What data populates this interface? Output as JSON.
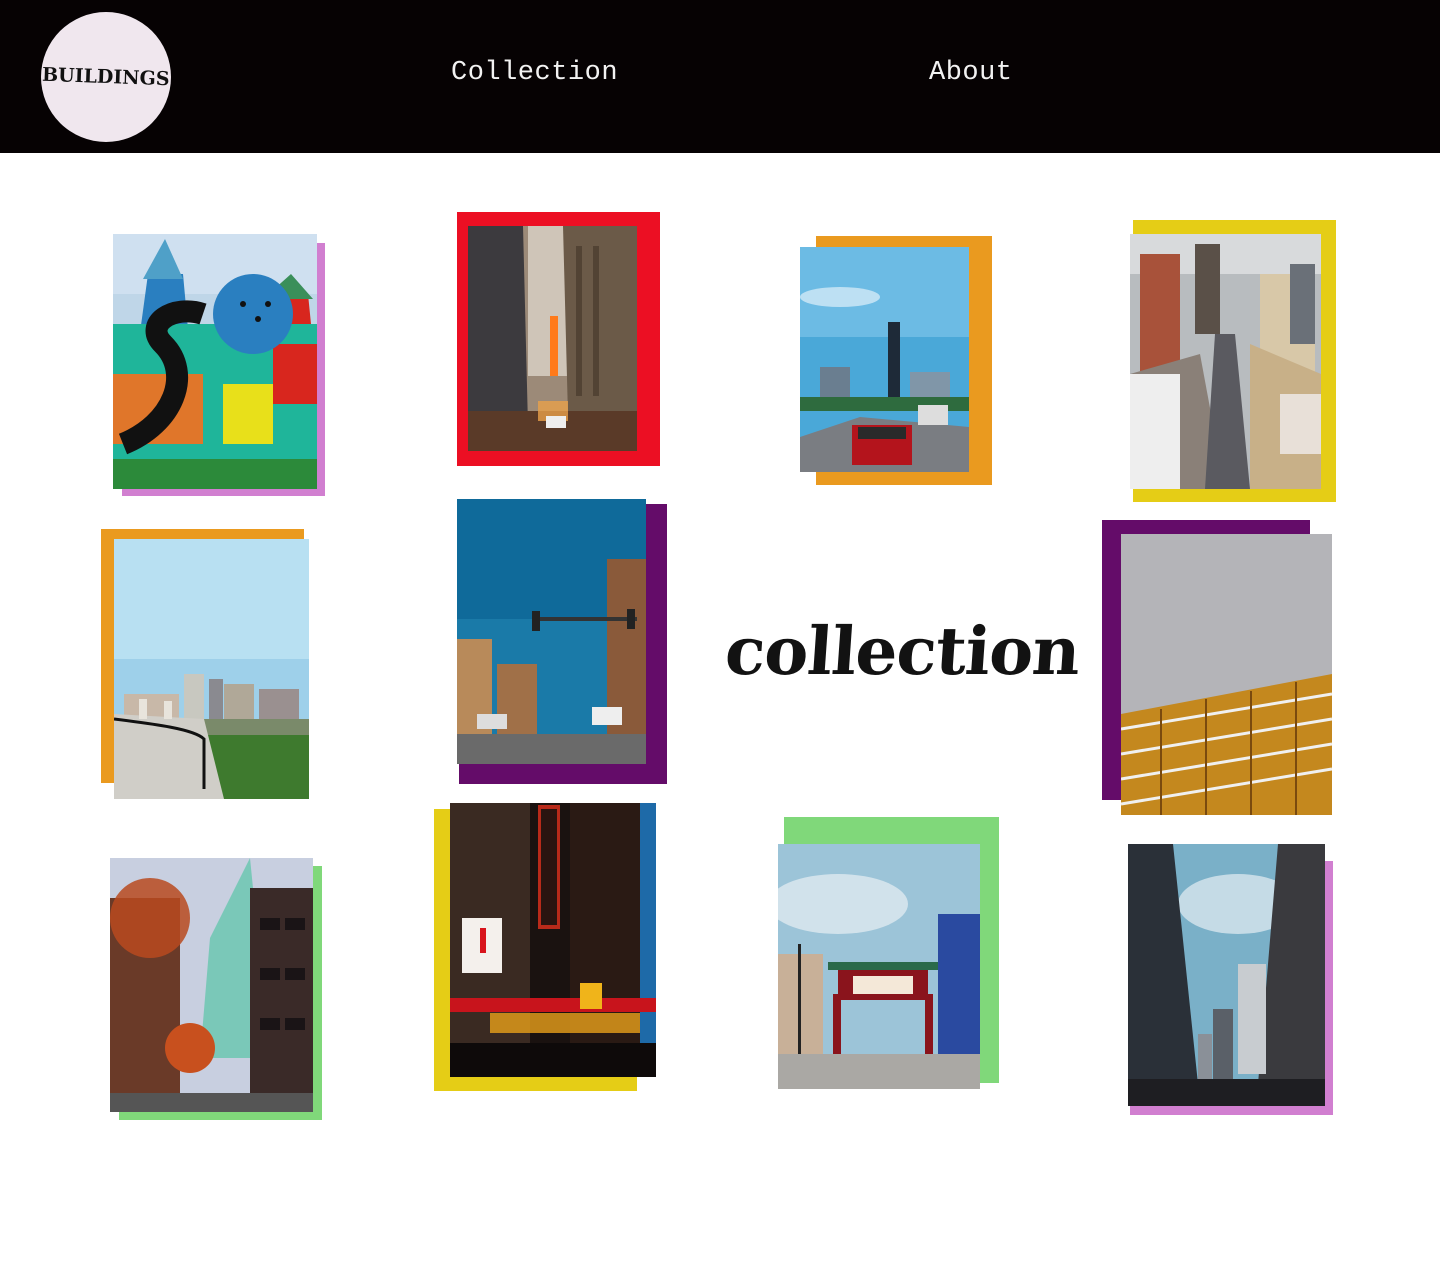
{
  "header": {
    "logo_text": "BUILDINGS",
    "nav": [
      {
        "label": "Collection"
      },
      {
        "label": "About"
      }
    ]
  },
  "main": {
    "title": "collection"
  },
  "colors": {
    "header_bg": "#060203",
    "logo_bg": "#f0e7ee",
    "pink": "#d17fd0",
    "red": "#ec0f23",
    "orange": "#ea9a1f",
    "yellow": "#e5cd16",
    "purple": "#640c69",
    "green": "#80d87a"
  },
  "gallery": [
    {
      "name": "mural-church-photo",
      "frame": "pink"
    },
    {
      "name": "theater-street-photo",
      "frame": "red"
    },
    {
      "name": "skyline-highway-photo",
      "frame": "orange"
    },
    {
      "name": "aerial-avenue-photo",
      "frame": "yellow"
    },
    {
      "name": "river-overlook-photo",
      "frame": "orange"
    },
    {
      "name": "traffic-light-street-photo",
      "frame": "purple"
    },
    {
      "name": "hotel-balconies-photo",
      "frame": "purple"
    },
    {
      "name": "glass-tower-trees-photo",
      "frame": "green"
    },
    {
      "name": "playhouse-square-photo",
      "frame": "yellow"
    },
    {
      "name": "chinatown-gate-photo",
      "frame": "green"
    },
    {
      "name": "canyon-skyscrapers-photo",
      "frame": "pink"
    }
  ]
}
